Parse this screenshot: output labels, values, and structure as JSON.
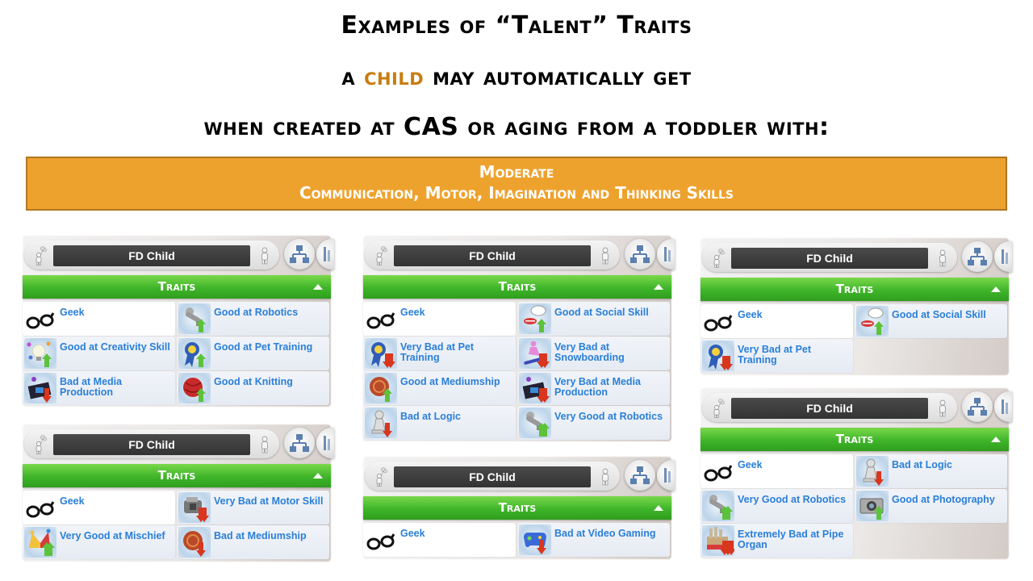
{
  "title": {
    "line1": "Examples of “Talent” Traits",
    "line2_pre": "a ",
    "line2_accent": "child",
    "line2_post": " may automatically get",
    "line3": "when created at CAS or aging from a toddler with:"
  },
  "colors": {
    "accent": "#c87d10",
    "banner": "#eea22e",
    "traits_bar": "#3fb52a",
    "trait_text": "#2a7fd8"
  },
  "banner": {
    "line1": "Moderate",
    "line2": "Communication, Motor, Imagination and Thinking Skills"
  },
  "panels": [
    {
      "sim_name": "FD Child",
      "section": "Traits",
      "traits": [
        {
          "label": "Geek",
          "icon": "glasses-icon"
        },
        {
          "label": "Good at Robotics",
          "icon": "robot-arm-icon"
        },
        {
          "label": "Good at Creativity Skill",
          "icon": "lightbulb-icon"
        },
        {
          "label": "Good at Pet Training",
          "icon": "ribbon-icon"
        },
        {
          "label": "Bad at Media Production",
          "icon": "film-icon"
        },
        {
          "label": "Good at Knitting",
          "icon": "yarn-icon"
        }
      ]
    },
    {
      "sim_name": "FD Child",
      "section": "Traits",
      "traits": [
        {
          "label": "Geek",
          "icon": "glasses-icon"
        },
        {
          "label": "Very Bad at Motor Skill",
          "icon": "engine-icon"
        },
        {
          "label": "Very Good at Mischief",
          "icon": "jester-hat-icon"
        },
        {
          "label": "Bad at Mediumship",
          "icon": "crystal-ball-icon"
        }
      ]
    },
    {
      "sim_name": "FD Child",
      "section": "Traits",
      "traits": [
        {
          "label": "Geek",
          "icon": "glasses-icon"
        },
        {
          "label": "Good at Social Skill",
          "icon": "speech-lips-icon"
        },
        {
          "label": "Very Bad at Pet Training",
          "icon": "ribbon-icon"
        },
        {
          "label": "Very Bad at Snowboarding",
          "icon": "snowboarder-icon"
        },
        {
          "label": "Good at Mediumship",
          "icon": "crystal-ball-icon"
        },
        {
          "label": "Very Bad at Media Production",
          "icon": "film-icon"
        },
        {
          "label": "Bad at Logic",
          "icon": "chess-pawn-icon"
        },
        {
          "label": "Very Good at Robotics",
          "icon": "robot-arm-icon"
        }
      ]
    },
    {
      "sim_name": "FD Child",
      "section": "Traits",
      "traits": [
        {
          "label": "Geek",
          "icon": "glasses-icon"
        },
        {
          "label": "Bad at Video Gaming",
          "icon": "gamepad-icon"
        }
      ]
    },
    {
      "sim_name": "FD Child",
      "section": "Traits",
      "traits": [
        {
          "label": "Geek",
          "icon": "glasses-icon"
        },
        {
          "label": "Good at Social Skill",
          "icon": "speech-lips-icon"
        },
        {
          "label": "Very Bad at Pet Training",
          "icon": "ribbon-icon"
        }
      ]
    },
    {
      "sim_name": "FD Child",
      "section": "Traits",
      "traits": [
        {
          "label": "Geek",
          "icon": "glasses-icon"
        },
        {
          "label": "Bad at Logic",
          "icon": "chess-pawn-icon"
        },
        {
          "label": "Very Good at Robotics",
          "icon": "robot-arm-icon"
        },
        {
          "label": "Good at Photography",
          "icon": "camera-icon"
        },
        {
          "label": "Extremely Bad at Pipe Organ",
          "icon": "pipe-organ-icon"
        }
      ]
    }
  ]
}
